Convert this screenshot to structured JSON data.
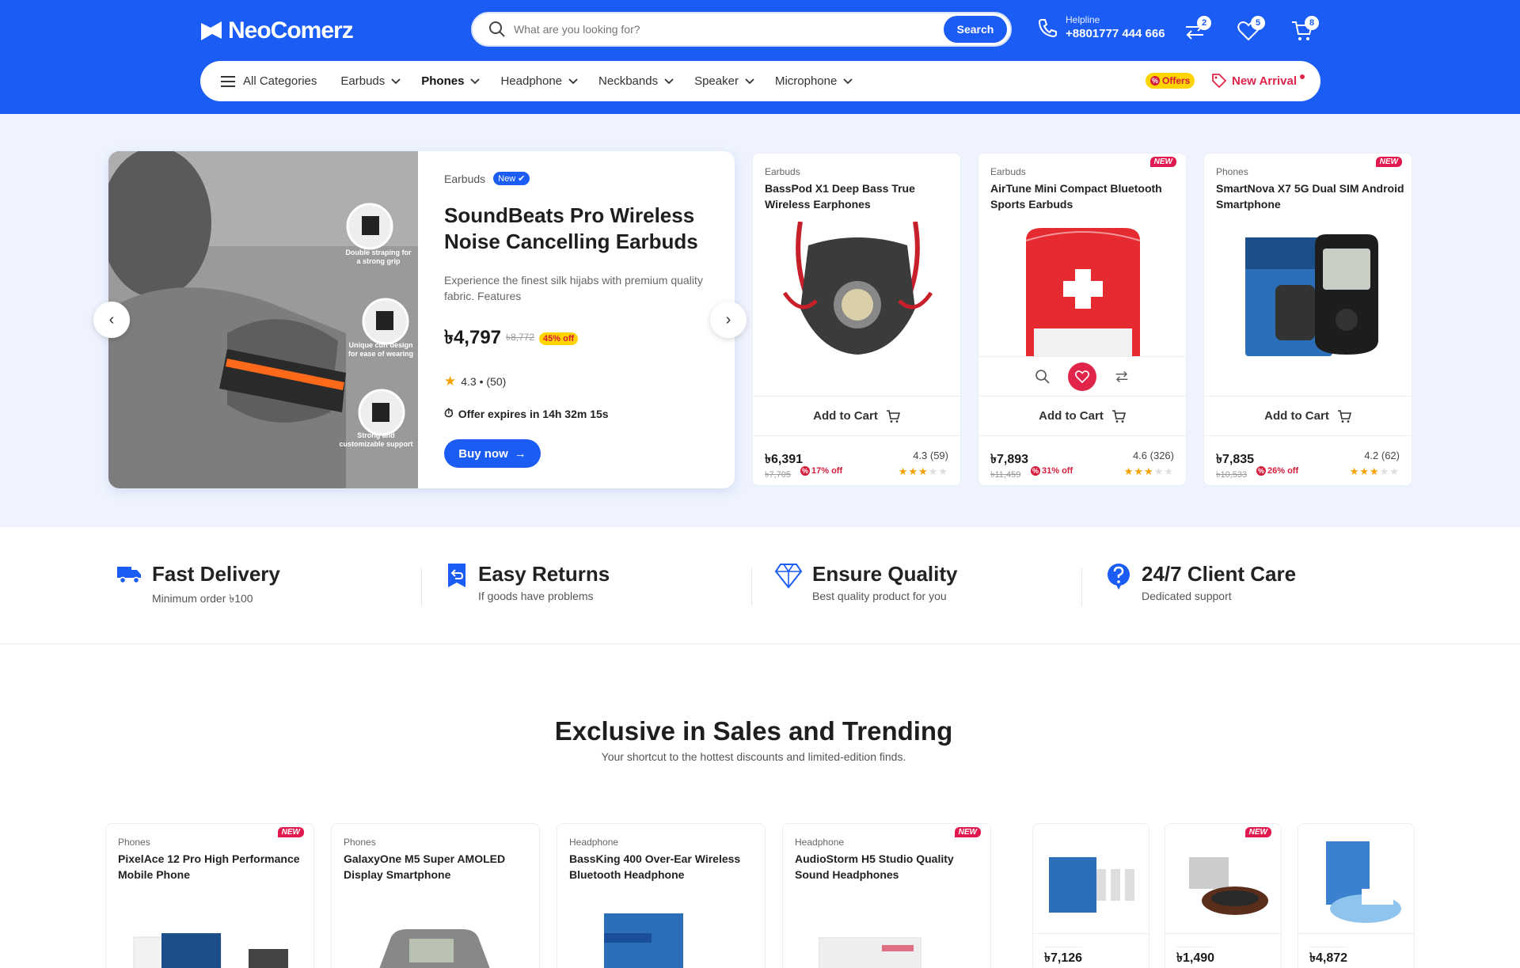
{
  "header": {
    "brand": "NeoComerz",
    "search_placeholder": "What are you looking for?",
    "search_button": "Search",
    "helpline_label": "Helpline",
    "helpline_number": "+8801777 444 666",
    "compare_count": "2",
    "wishlist_count": "5",
    "cart_count": "8"
  },
  "nav": {
    "all_categories": "All Categories",
    "items": [
      "Earbuds",
      "Phones",
      "Headphone",
      "Neckbands",
      "Speaker",
      "Microphone"
    ],
    "offers": "Offers",
    "new_arrival": "New Arrival"
  },
  "hero": {
    "category": "Earbuds",
    "badge": "New",
    "title": "SoundBeats Pro Wireless Noise Cancelling Earbuds",
    "description": "Experience the finest silk hijabs with premium quality fabric. Features",
    "price": "৳4,797",
    "old_price": "৳8,772",
    "discount": "45% off",
    "rating": "4.3 • (50)",
    "timer": "Offer expires in 14h 32m 15s",
    "cta": "Buy now",
    "image_callouts": [
      "Double straping for a strong grip",
      "Unique cuff design for ease of wearing",
      "Strong and customizable support"
    ]
  },
  "cards": [
    {
      "category": "Earbuds",
      "name": "BassPod X1 Deep Bass True Wireless Earphones",
      "is_new": "",
      "add_to_cart": "Add to Cart",
      "price": "৳6,391",
      "old_price": "৳7,705",
      "discount": "17% off",
      "rating": "4.3 (59)",
      "stars": 3,
      "image": "respirator-mask"
    },
    {
      "category": "Earbuds",
      "name": "AirTune Mini Compact Bluetooth Sports Earbuds",
      "is_new": "NEW",
      "add_to_cart": "Add to Cart",
      "price": "৳7,893",
      "old_price": "৳11,459",
      "discount": "31% off",
      "rating": "4.6 (326)",
      "stars": 3,
      "image": "first-aid-bag"
    },
    {
      "category": "Phones",
      "name": "SmartNova X7 5G Dual SIM Android Smartphone",
      "is_new": "NEW",
      "add_to_cart": "Add to Cart",
      "price": "৳7,835",
      "old_price": "৳10,533",
      "discount": "26% off",
      "rating": "4.2 (62)",
      "stars": 3,
      "image": "glucose-meter"
    }
  ],
  "features": [
    {
      "title": "Fast Delivery",
      "subtitle": "Minimum order ৳100",
      "icon": "truck-icon"
    },
    {
      "title": "Easy Returns",
      "subtitle": "If goods have problems",
      "icon": "return-icon"
    },
    {
      "title": "Ensure Quality",
      "subtitle": "Best quality product for you",
      "icon": "diamond-icon"
    },
    {
      "title": "24/7 Client Care",
      "subtitle": "Dedicated support",
      "icon": "help-icon"
    }
  ],
  "section": {
    "title": "Exclusive in Sales and Trending",
    "subtitle": "Your shortcut to the hottest discounts and limited-edition finds."
  },
  "products": [
    {
      "category": "Phones",
      "name": "PixelAce 12 Pro High Performance Mobile Phone",
      "is_new": "NEW"
    },
    {
      "category": "Phones",
      "name": "GalaxyOne M5 Super AMOLED Display Smartphone",
      "is_new": ""
    },
    {
      "category": "Headphone",
      "name": "BassKing 400 Over-Ear Wireless Bluetooth Headphone",
      "is_new": ""
    },
    {
      "category": "Headphone",
      "name": "AudioStorm H5 Studio Quality Sound Headphones",
      "is_new": "NEW"
    }
  ],
  "small_products": [
    {
      "price": "৳7,126",
      "is_new": ""
    },
    {
      "price": "৳1,490",
      "is_new": "NEW"
    },
    {
      "price": "৳4,872",
      "is_new": ""
    }
  ],
  "colors": {
    "brand": "#1a5cf4",
    "accent_red": "#e0244a",
    "offer_yellow": "#ffd400"
  }
}
